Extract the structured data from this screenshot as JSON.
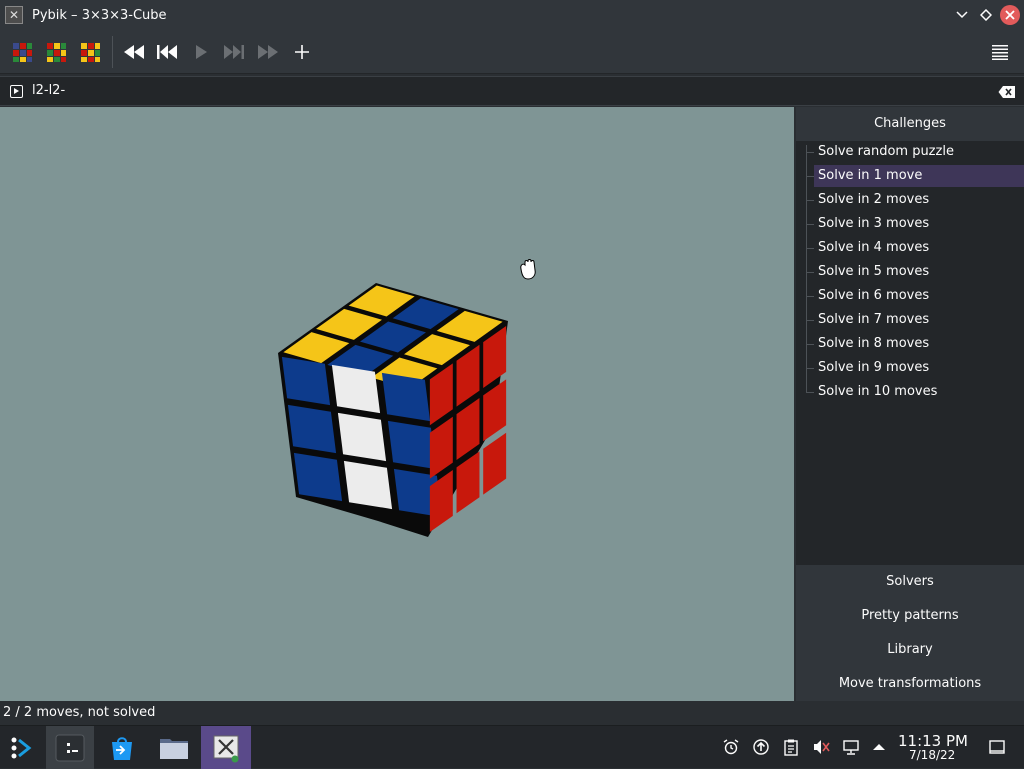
{
  "window": {
    "title": "Pybik – 3×3×3-Cube",
    "app_icon": "pybik-x-icon"
  },
  "toolbar": {
    "buttons": [
      {
        "name": "new-random-button",
        "icon": "cube-new-random-icon"
      },
      {
        "name": "new-solved-button",
        "icon": "cube-new-solved-icon"
      },
      {
        "name": "cube-select-button",
        "icon": "cube-select-icon"
      },
      {
        "name": "rewind-button",
        "icon": "rewind-icon"
      },
      {
        "name": "previous-button",
        "icon": "skip-back-icon"
      },
      {
        "name": "play-button",
        "icon": "play-icon"
      },
      {
        "name": "next-button",
        "icon": "skip-forward-icon"
      },
      {
        "name": "forward-button",
        "icon": "fast-forward-icon"
      },
      {
        "name": "add-mark-button",
        "icon": "plus-icon"
      }
    ],
    "menu_icon": "hamburger-menu-icon"
  },
  "command_bar": {
    "value": "l2-l2-"
  },
  "sidebar": {
    "challenges_header": "Challenges",
    "challenges": [
      "Solve random puzzle",
      "Solve in 1 move",
      "Solve in 2 moves",
      "Solve in 3 moves",
      "Solve in 4 moves",
      "Solve in 5 moves",
      "Solve in 6 moves",
      "Solve in 7 moves",
      "Solve in 8 moves",
      "Solve in 9 moves",
      "Solve in 10 moves"
    ],
    "selected_index": 1,
    "sections": [
      "Solvers",
      "Pretty patterns",
      "Library",
      "Move transformations"
    ]
  },
  "cube": {
    "colors": {
      "yellow": "#f5c518",
      "blue": "#0d3b8c",
      "white": "#ececec",
      "red": "#c8180c"
    }
  },
  "statusbar": {
    "text": "2 / 2 moves, not solved"
  },
  "taskbar": {
    "clock_time": "11:13 PM",
    "clock_date": "7/18/22",
    "tasks": [
      "app-launcher-icon",
      "terminal-icon",
      "store-icon",
      "file-manager-icon",
      "pybik-window-icon"
    ],
    "tray": [
      "alarm-icon",
      "update-icon",
      "clipboard-icon",
      "muted-speaker-icon",
      "network-icon",
      "tray-expand-icon",
      "show-desktop-icon"
    ]
  }
}
